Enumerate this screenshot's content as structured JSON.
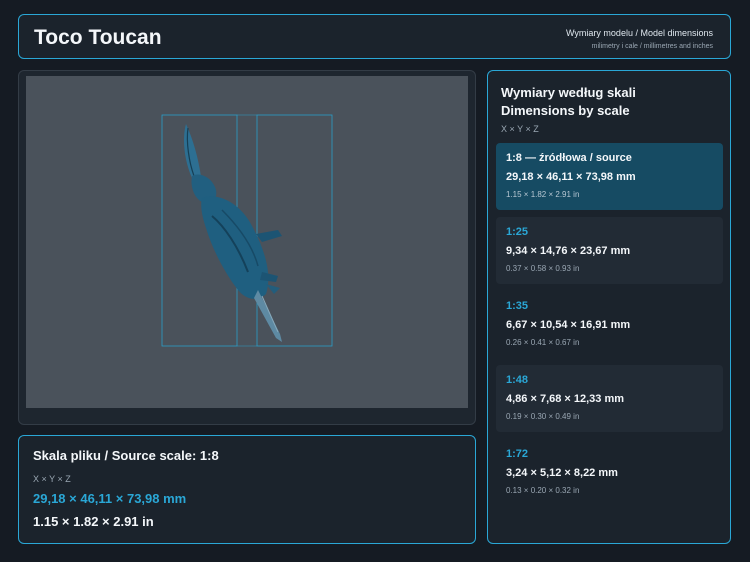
{
  "header": {
    "title": "Toco Toucan",
    "subtitle": "Wymiary modelu / Model dimensions",
    "caption": "milimetry i cale / millimetres and inches"
  },
  "source": {
    "title": "Skala pliku / Source scale: 1:8",
    "axes": "X × Y × Z",
    "mm": "29,18 × 46,11 × 73,98 mm",
    "inches": "1.15 × 1.82 × 2.91 in"
  },
  "scales": {
    "title_pl": "Wymiary według skali",
    "title_en": "Dimensions by scale",
    "axes": "X × Y × Z",
    "items": [
      {
        "label": "1:8  —  źródłowa / source",
        "mm": "29,18 × 46,11 × 73,98 mm",
        "inches": "1.15 × 1.82 × 2.91 in"
      },
      {
        "label": "1:25",
        "mm": "9,34 × 14,76 × 23,67 mm",
        "inches": "0.37 × 0.58 × 0.93 in"
      },
      {
        "label": "1:35",
        "mm": "6,67 × 10,54 × 16,91 mm",
        "inches": "0.26 × 0.41 × 0.67 in"
      },
      {
        "label": "1:48",
        "mm": "4,86 × 7,68 × 12,33 mm",
        "inches": "0.19 × 0.30 × 0.49 in"
      },
      {
        "label": "1:72",
        "mm": "3,24 × 5,12 × 8,22 mm",
        "inches": "0.13 × 0.20 × 0.32 in"
      }
    ]
  },
  "colors": {
    "accent": "#2aa7d6",
    "model": "#1f5f80",
    "active_card": "#164b63"
  },
  "icons": {
    "model": "toucan-model-render"
  }
}
